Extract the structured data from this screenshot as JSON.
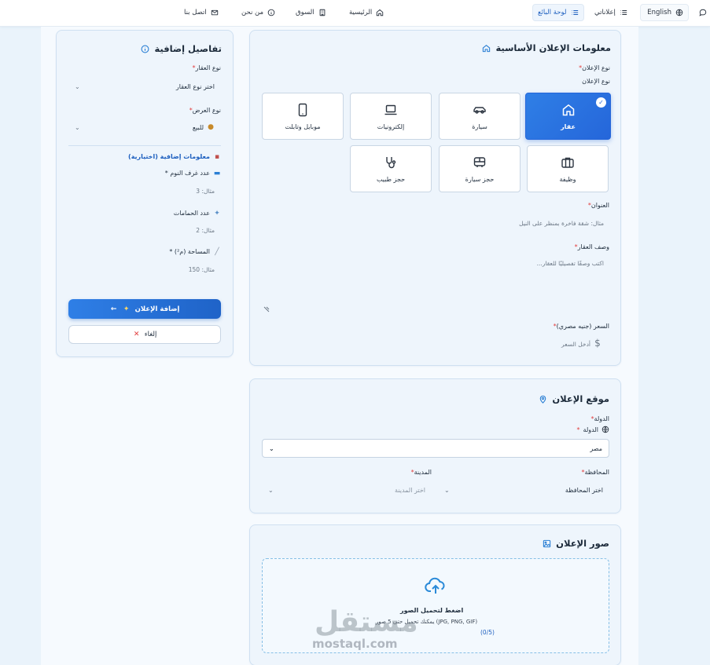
{
  "nav": {
    "language": "English",
    "my_ads": "إعلاناتي",
    "seller_dashboard": "لوحة البائع",
    "home": "الرئيسية",
    "market": "السوق",
    "about": "من نحن",
    "contact": "اتصل بنا"
  },
  "basic_info": {
    "title": "معلومات الإعلان الأساسية",
    "ad_type_label": "نوع الإعلان",
    "ad_type_sublabel": "نوع الإعلان",
    "types": [
      {
        "label": "عقار",
        "icon": "home-icon",
        "selected": true
      },
      {
        "label": "سيارة",
        "icon": "car-icon",
        "selected": false
      },
      {
        "label": "إلكترونيات",
        "icon": "laptop-icon",
        "selected": false
      },
      {
        "label": "موبايل وتابلت",
        "icon": "tablet-icon",
        "selected": false
      },
      {
        "label": "وظيفة",
        "icon": "briefcase-icon",
        "selected": false
      },
      {
        "label": "حجز سيارة",
        "icon": "bus-icon",
        "selected": false
      },
      {
        "label": "حجز طبيب",
        "icon": "stethoscope-icon",
        "selected": false
      }
    ],
    "title_label": "العنوان",
    "title_placeholder": "مثال: شقة فاخرة بمنظر على النيل",
    "description_label": "وصف العقار",
    "description_placeholder": "اكتب وصفًا تفصيليًا للعقار...",
    "price_label": "السعر (جنيه مصري)",
    "price_placeholder": "أدخل السعر"
  },
  "location": {
    "title": "موقع الإعلان",
    "country_label": "الدولة",
    "country_sublabel": "الدولة",
    "country_value": "مصر",
    "governorate_label": "المحافظة",
    "governorate_placeholder": "اختر المحافظة",
    "city_label": "المدينة",
    "city_placeholder": "اختر المدينة"
  },
  "photos": {
    "title": "صور الإعلان",
    "upload_title": "اضغط لتحميل الصور",
    "upload_hint": "يمكنك تحميل حتى 5 صور (JPG, PNG, GIF)",
    "upload_count": "(0/5)"
  },
  "extra": {
    "title": "تفاصيل إضافية",
    "property_type_label": "نوع العقار",
    "property_type_placeholder": "اختر نوع العقار",
    "offer_type_label": "نوع العرض",
    "offer_type_value": "للبيع",
    "optional_title": "معلومات إضافية (اختيارية)",
    "bedrooms_label": "عدد غرف النوم *",
    "bedrooms_placeholder": "مثال: 3",
    "bathrooms_label": "عدد الحمامات",
    "bathrooms_placeholder": "مثال: 2",
    "area_label": "المساحة (م²) *",
    "area_placeholder": "مثال: 150",
    "submit_label": "إضافة الإعلان",
    "cancel_label": "إلغاء"
  },
  "watermark": {
    "arabic": "مستقل",
    "latin": "mostaql.com"
  },
  "colors": {
    "primary": "#2566da",
    "accent_icon": "#2a7fd4",
    "required": "#e23c3c",
    "card_bg": "#eef5fc"
  }
}
